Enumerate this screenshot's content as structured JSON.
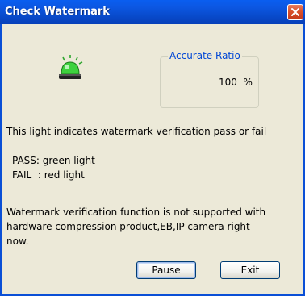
{
  "window": {
    "title": "Check Watermark"
  },
  "accuracy": {
    "legend": "Accurate Ratio",
    "value": "100",
    "unit": "%"
  },
  "messages": {
    "light_indicates": "This light indicates watermark verification pass or fail",
    "pass": "PASS: green light",
    "fail": "FAIL  : red light",
    "note_line1": "Watermark verification function is not supported with",
    "note_line2": "hardware compression product,EB,IP camera right",
    "note_line3": "now."
  },
  "buttons": {
    "pause": "Pause",
    "exit": "Exit"
  },
  "colors": {
    "light": "#33cc33",
    "title_bar": "#0a4fd6",
    "legend": "#0046d5"
  },
  "icons": {
    "status_light": "green-siren-icon",
    "close": "close-icon"
  }
}
